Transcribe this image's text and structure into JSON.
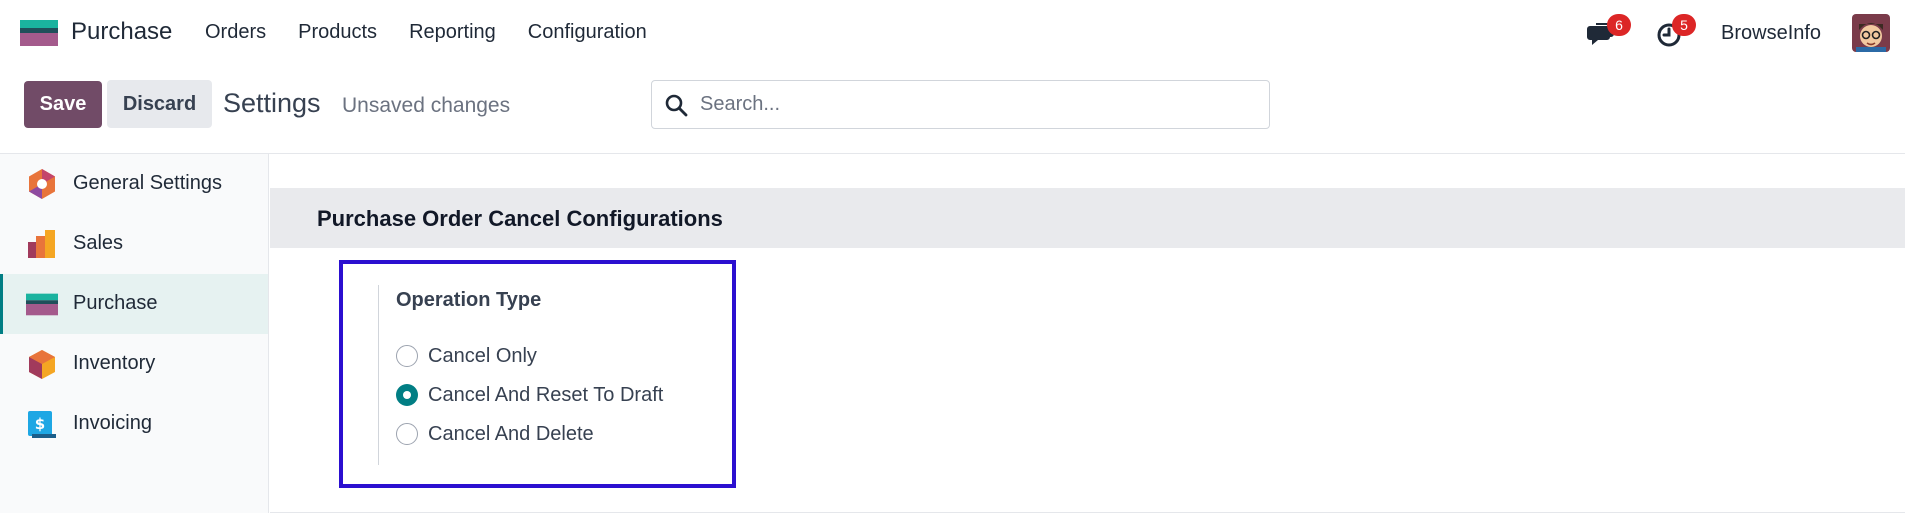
{
  "navbar": {
    "app_name": "Purchase",
    "menu": [
      "Orders",
      "Products",
      "Reporting",
      "Configuration"
    ],
    "messages_count": "6",
    "activities_count": "5",
    "company": "BrowseInfo"
  },
  "control_panel": {
    "save_label": "Save",
    "discard_label": "Discard",
    "title": "Settings",
    "status": "Unsaved changes",
    "search_placeholder": "Search..."
  },
  "sidebar": {
    "items": [
      {
        "label": "General Settings",
        "icon": "general-settings-icon",
        "active": false
      },
      {
        "label": "Sales",
        "icon": "sales-icon",
        "active": false
      },
      {
        "label": "Purchase",
        "icon": "purchase-icon",
        "active": true
      },
      {
        "label": "Inventory",
        "icon": "inventory-icon",
        "active": false
      },
      {
        "label": "Invoicing",
        "icon": "invoicing-icon",
        "active": false
      }
    ]
  },
  "section": {
    "title": "Purchase Order Cancel Configurations",
    "setting_label": "Operation Type",
    "options": [
      {
        "label": "Cancel Only",
        "checked": false
      },
      {
        "label": "Cancel And Reset To Draft",
        "checked": true
      },
      {
        "label": "Cancel And Delete",
        "checked": false
      }
    ]
  },
  "colors": {
    "brand": "#714b67",
    "accent": "#017e84",
    "highlight_box": "#2b0fd0",
    "badge": "#dc2626"
  }
}
